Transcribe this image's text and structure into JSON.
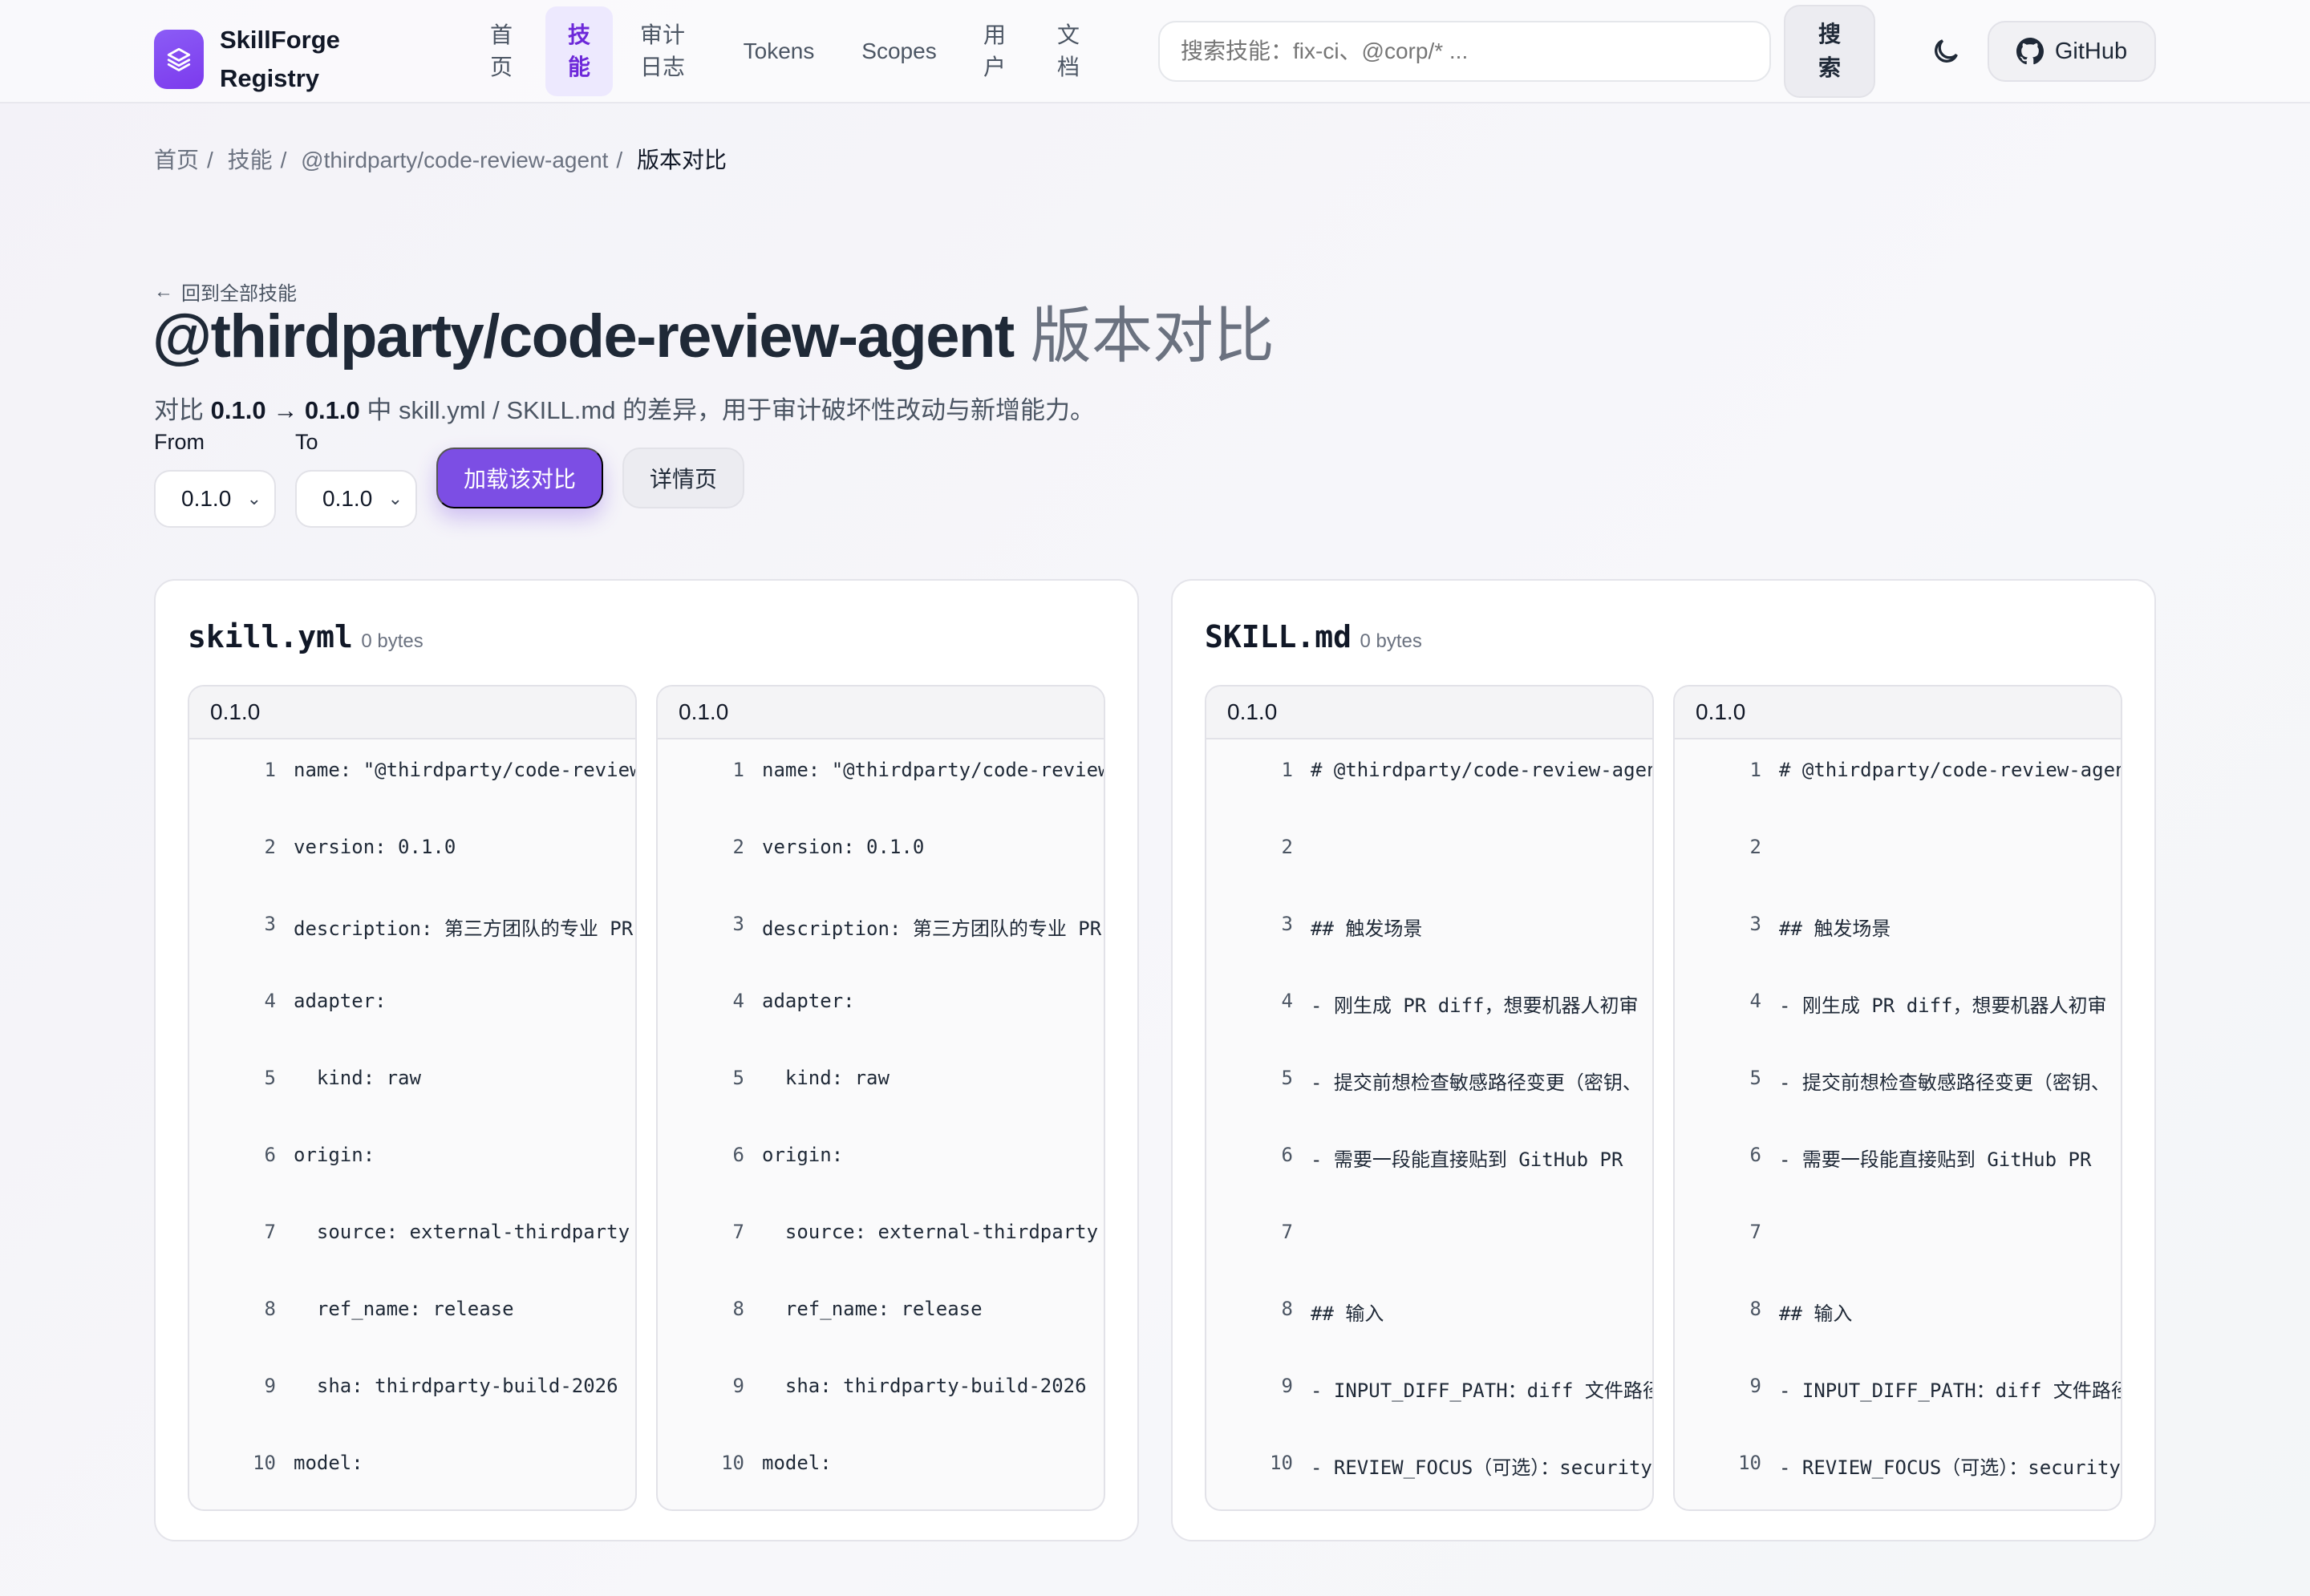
{
  "brand": {
    "name": "SkillForge Registry",
    "line1": "SkillForge",
    "line2": "Registry"
  },
  "nav": {
    "items": [
      {
        "label": "首\n页",
        "active": false
      },
      {
        "label": "技\n能",
        "active": true
      },
      {
        "label": "审计\n日志",
        "active": false
      },
      {
        "label": "Tokens",
        "active": false
      },
      {
        "label": "Scopes",
        "active": false
      },
      {
        "label": "用\n户",
        "active": false
      },
      {
        "label": "文\n档",
        "active": false
      }
    ]
  },
  "search": {
    "placeholder": "搜索技能：fix-ci、@corp/* ...",
    "button": "搜\n索"
  },
  "github": {
    "label": "GitHub"
  },
  "breadcrumb": [
    "首页",
    "技能",
    "@thirdparty/code-review-agent",
    "版本对比"
  ],
  "back_link": "回到全部技能",
  "title": {
    "main": "@thirdparty/code-review-agent",
    "suffix": " 版本对比"
  },
  "subtitle": {
    "prefix": "对比 ",
    "from": "0.1.0",
    "arrow": " → ",
    "to": "0.1.0",
    "rest": " 中 skill.yml / SKILL.md 的差异，用于审计破坏性改动与新增能力。"
  },
  "controls": {
    "from_label": "From",
    "to_label": "To",
    "from_value": "0.1.0",
    "to_value": "0.1.0",
    "load_button": "加载该对比",
    "detail_button": "详情页"
  },
  "panels": [
    {
      "filename": "skill.yml",
      "size": "0 bytes",
      "columns": [
        {
          "version": "0.1.0",
          "lines": [
            {
              "n": "1",
              "t": "name: \"@thirdparty/code-review-agent\""
            },
            {
              "n": "2",
              "t": "version: 0.1.0"
            },
            {
              "n": "3",
              "t": "description: 第三方团队的专业 PR 评审"
            },
            {
              "n": "4",
              "t": "adapter:"
            },
            {
              "n": "5",
              "t": "  kind: raw"
            },
            {
              "n": "6",
              "t": "origin:"
            },
            {
              "n": "7",
              "t": "  source: external-thirdparty"
            },
            {
              "n": "8",
              "t": "  ref_name: release"
            },
            {
              "n": "9",
              "t": "  sha: thirdparty-build-2026"
            },
            {
              "n": "10",
              "t": "model:"
            }
          ]
        },
        {
          "version": "0.1.0",
          "lines": [
            {
              "n": "1",
              "t": "name: \"@thirdparty/code-review-agent\""
            },
            {
              "n": "2",
              "t": "version: 0.1.0"
            },
            {
              "n": "3",
              "t": "description: 第三方团队的专业 PR 评审"
            },
            {
              "n": "4",
              "t": "adapter:"
            },
            {
              "n": "5",
              "t": "  kind: raw"
            },
            {
              "n": "6",
              "t": "origin:"
            },
            {
              "n": "7",
              "t": "  source: external-thirdparty"
            },
            {
              "n": "8",
              "t": "  ref_name: release"
            },
            {
              "n": "9",
              "t": "  sha: thirdparty-build-2026"
            },
            {
              "n": "10",
              "t": "model:"
            }
          ]
        }
      ]
    },
    {
      "filename": "SKILL.md",
      "size": "0 bytes",
      "columns": [
        {
          "version": "0.1.0",
          "lines": [
            {
              "n": "1",
              "t": "# @thirdparty/code-review-agent"
            },
            {
              "n": "2",
              "t": ""
            },
            {
              "n": "3",
              "t": "## 触发场景"
            },
            {
              "n": "4",
              "t": "- 刚生成 PR diff，想要机器人初审"
            },
            {
              "n": "5",
              "t": "- 提交前想检查敏感路径变更（密钥、"
            },
            {
              "n": "6",
              "t": "- 需要一段能直接贴到 GitHub PR"
            },
            {
              "n": "7",
              "t": ""
            },
            {
              "n": "8",
              "t": "## 输入"
            },
            {
              "n": "9",
              "t": "- INPUT_DIFF_PATH：diff 文件路径"
            },
            {
              "n": "10",
              "t": "- REVIEW_FOCUS（可选）：security"
            }
          ]
        },
        {
          "version": "0.1.0",
          "lines": [
            {
              "n": "1",
              "t": "# @thirdparty/code-review-agent"
            },
            {
              "n": "2",
              "t": ""
            },
            {
              "n": "3",
              "t": "## 触发场景"
            },
            {
              "n": "4",
              "t": "- 刚生成 PR diff，想要机器人初审"
            },
            {
              "n": "5",
              "t": "- 提交前想检查敏感路径变更（密钥、"
            },
            {
              "n": "6",
              "t": "- 需要一段能直接贴到 GitHub PR"
            },
            {
              "n": "7",
              "t": ""
            },
            {
              "n": "8",
              "t": "## 输入"
            },
            {
              "n": "9",
              "t": "- INPUT_DIFF_PATH：diff 文件路径"
            },
            {
              "n": "10",
              "t": "- REVIEW_FOCUS（可选）：security"
            }
          ]
        }
      ]
    }
  ],
  "colors": {
    "accent": "#7c4ee4",
    "active_nav_bg": "#ede9fe",
    "active_nav_text": "#6d28d9"
  },
  "icons": {
    "brand": "layers-icon",
    "back": "arrow-left-icon",
    "theme": "moon-icon",
    "github": "github-icon",
    "select": "chevron-down-icon"
  }
}
